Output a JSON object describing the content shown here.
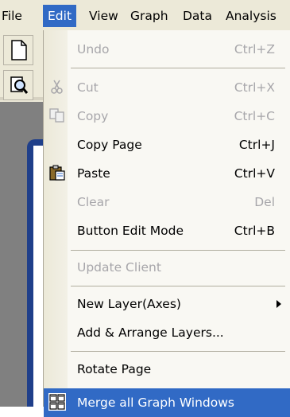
{
  "menubar": {
    "items": [
      "File",
      "Edit",
      "View",
      "Graph",
      "Data",
      "Analysis"
    ]
  },
  "edit_menu": {
    "items": [
      {
        "label": "Undo",
        "shortcut": "Ctrl+Z",
        "enabled": false
      },
      {
        "label": "Cut",
        "shortcut": "Ctrl+X",
        "enabled": false,
        "icon": "scissors-icon"
      },
      {
        "label": "Copy",
        "shortcut": "Ctrl+C",
        "enabled": false,
        "icon": "copy-icon"
      },
      {
        "label": "Copy Page",
        "shortcut": "Ctrl+J",
        "enabled": true
      },
      {
        "label": "Paste",
        "shortcut": "Ctrl+V",
        "enabled": true,
        "icon": "paste-clipboard-icon"
      },
      {
        "label": "Clear",
        "shortcut": "Del",
        "enabled": false
      },
      {
        "label": "Button Edit Mode",
        "shortcut": "Ctrl+B",
        "enabled": true
      },
      {
        "label": "Update Client",
        "shortcut": "",
        "enabled": false
      },
      {
        "label": "New Layer(Axes)",
        "shortcut": "",
        "enabled": true,
        "submenu": true
      },
      {
        "label": "Add & Arrange Layers...",
        "shortcut": "",
        "enabled": true
      },
      {
        "label": "Rotate Page",
        "shortcut": "",
        "enabled": true
      },
      {
        "label": "Merge all Graph Windows",
        "shortcut": "",
        "enabled": true,
        "highlighted": true,
        "icon": "merge-windows-icon"
      }
    ]
  },
  "colors": {
    "highlight": "#316ac5",
    "menu_bg": "#f9f8f3",
    "disabled_text": "#a7a6aa"
  }
}
